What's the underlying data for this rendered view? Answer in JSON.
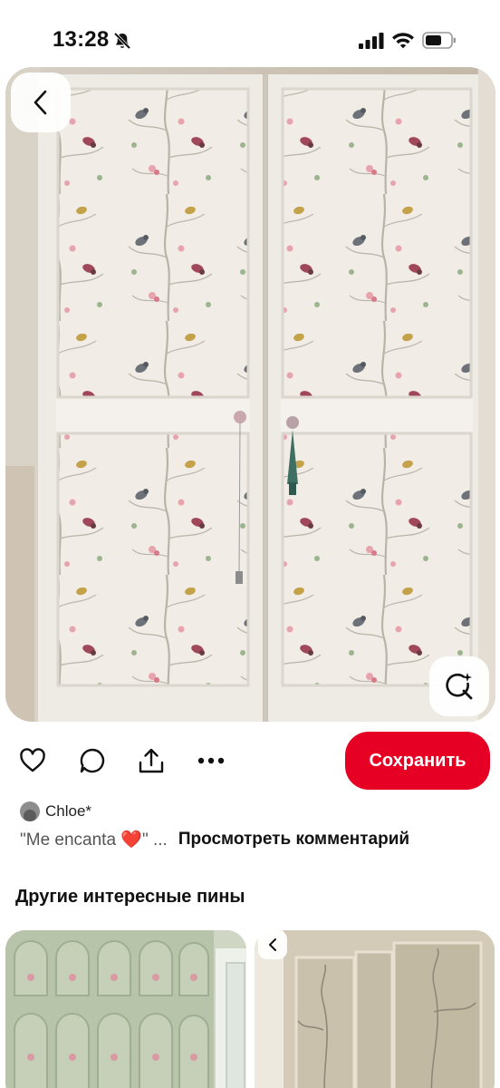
{
  "status_bar": {
    "time": "13:28",
    "icons": [
      "bell-slash-icon",
      "signal-icon",
      "wifi-icon",
      "battery-icon"
    ]
  },
  "pin": {
    "image_subject": "white double wardrobe doors with bird and blossom wallpaper panels",
    "back_icon": "chevron-left-icon",
    "lens_icon": "visual-search-icon"
  },
  "actions": {
    "icons": [
      "heart-icon",
      "comment-icon",
      "share-icon",
      "more-icon"
    ],
    "save_label": "Сохранить",
    "save_color": "#e60023"
  },
  "comment": {
    "author": "Chloe*",
    "text": "\"Me encanta ❤️\" ...",
    "view_link": "Просмотреть комментарий"
  },
  "more_pins": {
    "title": "Другие интересные пины"
  }
}
